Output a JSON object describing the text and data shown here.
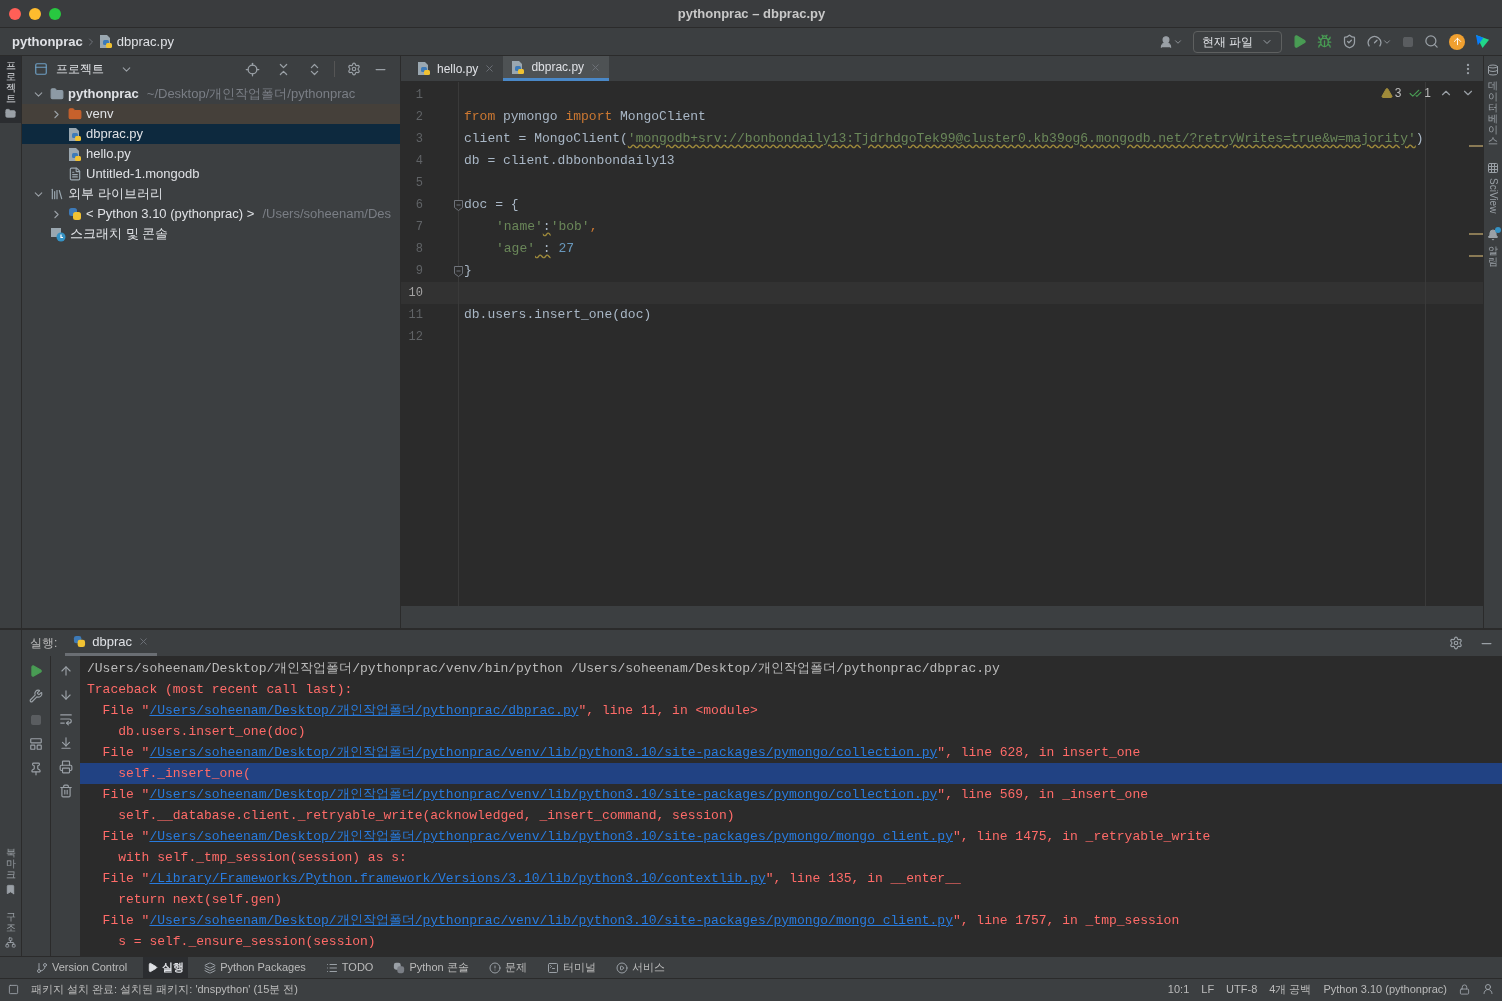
{
  "window": {
    "title": "pythonprac – dbprac.py"
  },
  "breadcrumb": [
    "pythonprac",
    "dbprac.py"
  ],
  "toolbar": {
    "run_config": "현재 파일"
  },
  "left_strip": [
    {
      "label": "프로젝트",
      "selected": true,
      "kind": "project"
    },
    {
      "label": "북마크",
      "selected": false,
      "kind": "bookmark"
    },
    {
      "label": "구조",
      "selected": false,
      "kind": "structure"
    }
  ],
  "project": {
    "title": "프로젝트",
    "tree": [
      {
        "name": "pythonprac",
        "path": "~/Desktop/개인작업폴더/pythonprac",
        "kind": "folder",
        "expanded": true,
        "selected": false,
        "children": [
          {
            "name": "venv",
            "kind": "excluded-folder",
            "expanded": false,
            "selected": false
          },
          {
            "name": "dbprac.py",
            "kind": "python-file",
            "selected": true
          },
          {
            "name": "hello.py",
            "kind": "python-file",
            "selected": false
          },
          {
            "name": "Untitled-1.mongodb",
            "kind": "file",
            "selected": false
          }
        ]
      },
      {
        "name": "외부 라이브러리",
        "kind": "library",
        "expanded": true,
        "selected": false,
        "children": [
          {
            "name": "< Python 3.10 (pythonprac) >",
            "path": "/Users/soheenam/Des",
            "kind": "python-sdk",
            "expanded": false,
            "selected": false
          }
        ]
      },
      {
        "name": "스크래치 및 콘솔",
        "kind": "scratch",
        "selected": false
      }
    ]
  },
  "editor": {
    "tabs": [
      {
        "label": "hello.py",
        "selected": false
      },
      {
        "label": "dbprac.py",
        "selected": true
      }
    ],
    "warnings": "3",
    "weak_warnings": "1",
    "lines": [
      {
        "number": "1",
        "current": false
      },
      {
        "number": "2",
        "current": false,
        "tokens": [
          {
            "text": "from",
            "kind": "kw"
          },
          {
            "text": " pymongo ",
            "kind": "plain"
          },
          {
            "text": "import",
            "kind": "kw"
          },
          {
            "text": " MongoClient",
            "kind": "plain"
          }
        ]
      },
      {
        "number": "3",
        "current": false,
        "tokens": [
          {
            "text": "client = MongoClient(",
            "kind": "plain"
          },
          {
            "text": "'mongodb+srv://bonbondaily13:TjdrhdgoTek99@cluster0.kb39og6.mongodb.net/?retryWrites=true&w=majority'",
            "kind": "str-warn"
          },
          {
            "text": ")",
            "kind": "plain"
          }
        ]
      },
      {
        "number": "4",
        "current": false,
        "tokens": [
          {
            "text": "db = client.dbbonbondaily13",
            "kind": "plain"
          }
        ]
      },
      {
        "number": "5",
        "current": false
      },
      {
        "number": "6",
        "current": false,
        "fold": true,
        "tokens": [
          {
            "text": "doc = {",
            "kind": "plain"
          }
        ]
      },
      {
        "number": "7",
        "current": false,
        "indent": true,
        "tokens": [
          {
            "text": "'name'",
            "kind": "str"
          },
          {
            "text": ":",
            "kind": "plain-warn"
          },
          {
            "text": "'bob'",
            "kind": "str"
          },
          {
            "text": ",",
            "kind": "kw"
          }
        ]
      },
      {
        "number": "8",
        "current": false,
        "indent": true,
        "tokens": [
          {
            "text": "'age'",
            "kind": "str"
          },
          {
            "text": " :",
            "kind": "plain-warn"
          },
          {
            "text": " 27",
            "kind": "num"
          }
        ]
      },
      {
        "number": "9",
        "current": false,
        "fold": true,
        "tokens": [
          {
            "text": "}",
            "kind": "plain"
          }
        ]
      },
      {
        "number": "10",
        "current": true
      },
      {
        "number": "11",
        "current": false,
        "tokens": [
          {
            "text": "db.users.insert_one(doc)",
            "kind": "plain"
          }
        ]
      },
      {
        "number": "12",
        "current": false
      }
    ]
  },
  "right_strip": [
    {
      "label": "데이터베이스",
      "kind": "database"
    },
    {
      "label": "SciView",
      "kind": "sciview"
    },
    {
      "label": "알림",
      "kind": "notifications"
    }
  ],
  "run": {
    "label": "실행:",
    "tabs": [
      {
        "label": "dbprac",
        "selected": true
      }
    ],
    "lines": [
      {
        "selected": false,
        "segments": [
          {
            "text": "/Users/soheenam/Desktop/개인작업폴더/pythonprac/venv/bin/python /Users/soheenam/Desktop/개인작업폴더/pythonprac/dbprac.py",
            "kind": "out"
          }
        ]
      },
      {
        "selected": false,
        "segments": [
          {
            "text": "Traceback (most recent call last):",
            "kind": "err"
          }
        ]
      },
      {
        "selected": false,
        "segments": [
          {
            "text": "  File \"",
            "kind": "err"
          },
          {
            "text": "/Users/soheenam/Desktop/개인작업폴더/pythonprac/dbprac.py",
            "kind": "link"
          },
          {
            "text": "\", line 11, in <module>",
            "kind": "err"
          }
        ]
      },
      {
        "selected": false,
        "segments": [
          {
            "text": "    db.users.insert_one(doc)",
            "kind": "err"
          }
        ]
      },
      {
        "selected": false,
        "segments": [
          {
            "text": "  File \"",
            "kind": "err"
          },
          {
            "text": "/Users/soheenam/Desktop/개인작업폴더/pythonprac/venv/lib/python3.10/site-packages/pymongo/collection.py",
            "kind": "link"
          },
          {
            "text": "\", line 628, in insert_one",
            "kind": "err"
          }
        ]
      },
      {
        "selected": true,
        "segments": [
          {
            "text": "    self._insert_one(",
            "kind": "err"
          }
        ]
      },
      {
        "selected": false,
        "segments": [
          {
            "text": "  File \"",
            "kind": "err"
          },
          {
            "text": "/Users/soheenam/Desktop/개인작업폴더/pythonprac/venv/lib/python3.10/site-packages/pymongo/collection.py",
            "kind": "link"
          },
          {
            "text": "\", line 569, in _insert_one",
            "kind": "err"
          }
        ]
      },
      {
        "selected": false,
        "segments": [
          {
            "text": "    self.__database.client._retryable_write(acknowledged, _insert_command, session)",
            "kind": "err"
          }
        ]
      },
      {
        "selected": false,
        "segments": [
          {
            "text": "  File \"",
            "kind": "err"
          },
          {
            "text": "/Users/soheenam/Desktop/개인작업폴더/pythonprac/venv/lib/python3.10/site-packages/pymongo/mongo_client.py",
            "kind": "link"
          },
          {
            "text": "\", line 1475, in _retryable_write",
            "kind": "err"
          }
        ]
      },
      {
        "selected": false,
        "segments": [
          {
            "text": "    with self._tmp_session(session) as s:",
            "kind": "err"
          }
        ]
      },
      {
        "selected": false,
        "segments": [
          {
            "text": "  File \"",
            "kind": "err"
          },
          {
            "text": "/Library/Frameworks/Python.framework/Versions/3.10/lib/python3.10/contextlib.py",
            "kind": "link"
          },
          {
            "text": "\", line 135, in __enter__",
            "kind": "err"
          }
        ]
      },
      {
        "selected": false,
        "segments": [
          {
            "text": "    return next(self.gen)",
            "kind": "err"
          }
        ]
      },
      {
        "selected": false,
        "segments": [
          {
            "text": "  File \"",
            "kind": "err"
          },
          {
            "text": "/Users/soheenam/Desktop/개인작업폴더/pythonprac/venv/lib/python3.10/site-packages/pymongo/mongo_client.py",
            "kind": "link"
          },
          {
            "text": "\", line 1757, in _tmp_session",
            "kind": "err"
          }
        ]
      },
      {
        "selected": false,
        "segments": [
          {
            "text": "    s = self._ensure_session(session)",
            "kind": "err"
          }
        ]
      }
    ]
  },
  "tool_windows": [
    {
      "label": "Version Control",
      "kind": "vcs",
      "selected": false
    },
    {
      "label": "실행",
      "kind": "run",
      "selected": true
    },
    {
      "label": "Python Packages",
      "kind": "packages",
      "selected": false
    },
    {
      "label": "TODO",
      "kind": "todo",
      "selected": false
    },
    {
      "label": "Python 콘솔",
      "kind": "console",
      "selected": false
    },
    {
      "label": "문제",
      "kind": "problems",
      "selected": false
    },
    {
      "label": "터미널",
      "kind": "terminal",
      "selected": false
    },
    {
      "label": "서비스",
      "kind": "services",
      "selected": false
    }
  ],
  "status": {
    "message": "패키지 설치 완료: 설치된 패키지: 'dnspython' (15분 전)",
    "items": [
      "10:1",
      "LF",
      "UTF-8",
      "4개 공백",
      "Python 3.10 (pythonprac)"
    ]
  }
}
